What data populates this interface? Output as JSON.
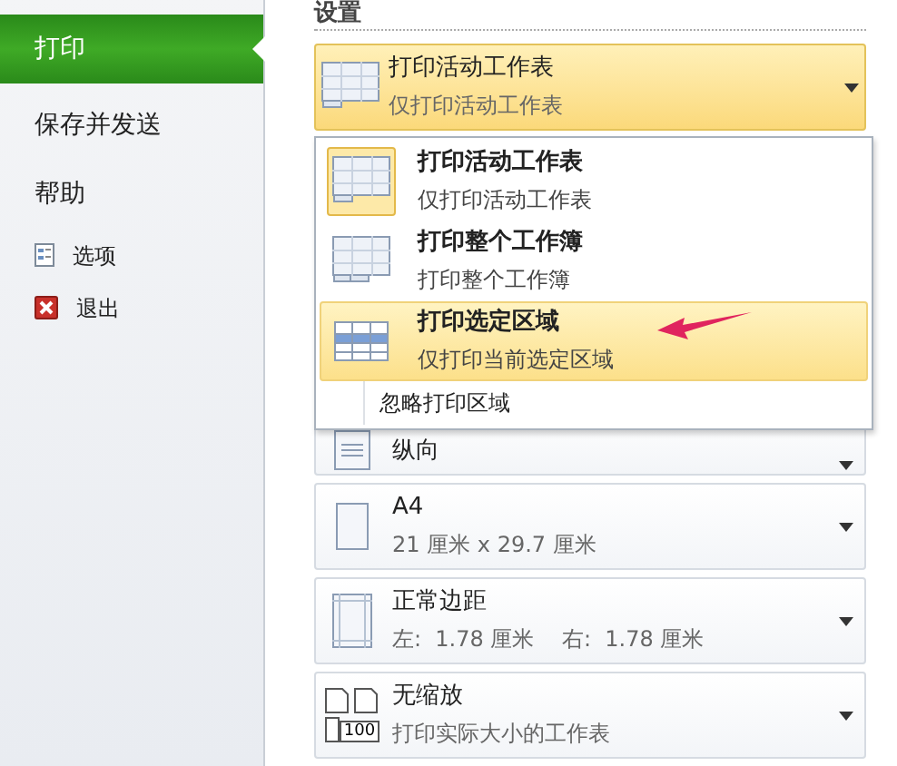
{
  "sidebar": {
    "items": [
      {
        "label": "打印",
        "kind": "tab",
        "selected": true
      },
      {
        "label": "保存并发送",
        "kind": "tab",
        "selected": false
      },
      {
        "label": "帮助",
        "kind": "tab",
        "selected": false
      },
      {
        "label": "选项",
        "kind": "options",
        "selected": false
      },
      {
        "label": "退出",
        "kind": "exit",
        "selected": false
      }
    ]
  },
  "settings": {
    "title": "设置",
    "print_what": {
      "title": "打印活动工作表",
      "subtitle": "仅打印活动工作表"
    },
    "menu": {
      "items": [
        {
          "kind": "sheet",
          "title": "打印活动工作表",
          "subtitle": "仅打印活动工作表",
          "selected": true,
          "hovered": false
        },
        {
          "kind": "workbook",
          "title": "打印整个工作簿",
          "subtitle": "打印整个工作簿",
          "selected": false,
          "hovered": false
        },
        {
          "kind": "selection",
          "title": "打印选定区域",
          "subtitle": "仅打印当前选定区域",
          "selected": false,
          "hovered": true
        }
      ],
      "footer": "忽略打印区域"
    },
    "rows": [
      {
        "kind": "orientation",
        "title": "纵向"
      },
      {
        "kind": "paper",
        "title": "A4",
        "subtitle": "21 厘米 x 29.7 厘米"
      },
      {
        "kind": "margins",
        "title": "正常边距",
        "subtitle": "左:  1.78 厘米    右:  1.78 厘米"
      },
      {
        "kind": "scaling",
        "title": "无缩放",
        "subtitle": "打印实际大小的工作表",
        "icon_text": "100"
      }
    ]
  }
}
